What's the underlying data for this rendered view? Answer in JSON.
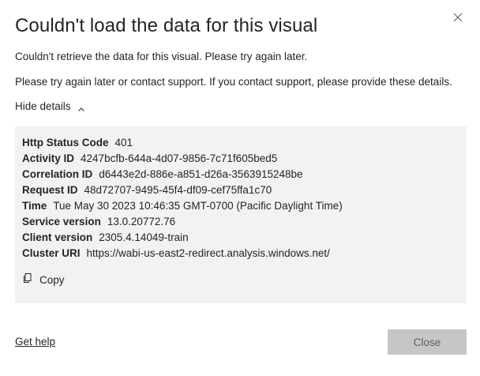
{
  "dialog": {
    "title": "Couldn't load the data for this visual",
    "message": "Couldn't retrieve the data for this visual. Please try again later.",
    "support_message": "Please try again later or contact support. If you contact support, please provide these details.",
    "toggle_label": "Hide details",
    "details": [
      {
        "key": "Http Status Code",
        "value": "401"
      },
      {
        "key": "Activity ID",
        "value": "4247bcfb-644a-4d07-9856-7c71f605bed5"
      },
      {
        "key": "Correlation ID",
        "value": "d6443e2d-886e-a851-d26a-3563915248be"
      },
      {
        "key": "Request ID",
        "value": "48d72707-9495-45f4-df09-cef75ffa1c70"
      },
      {
        "key": "Time",
        "value": "Tue May 30 2023 10:46:35 GMT-0700 (Pacific Daylight Time)"
      },
      {
        "key": "Service version",
        "value": "13.0.20772.76"
      },
      {
        "key": "Client version",
        "value": "2305.4.14049-train"
      },
      {
        "key": "Cluster URI",
        "value": "https://wabi-us-east2-redirect.analysis.windows.net/"
      }
    ],
    "copy_label": "Copy",
    "help_link": "Get help",
    "close_label": "Close"
  },
  "icons": {
    "close": "close-icon",
    "chevron": "chevron-up-icon",
    "copy": "copy-icon"
  },
  "colors": {
    "text": "#252423",
    "details_bg": "#f3f2f1",
    "close_button_bg": "#c8c6c4",
    "close_button_text": "#605e5c"
  }
}
